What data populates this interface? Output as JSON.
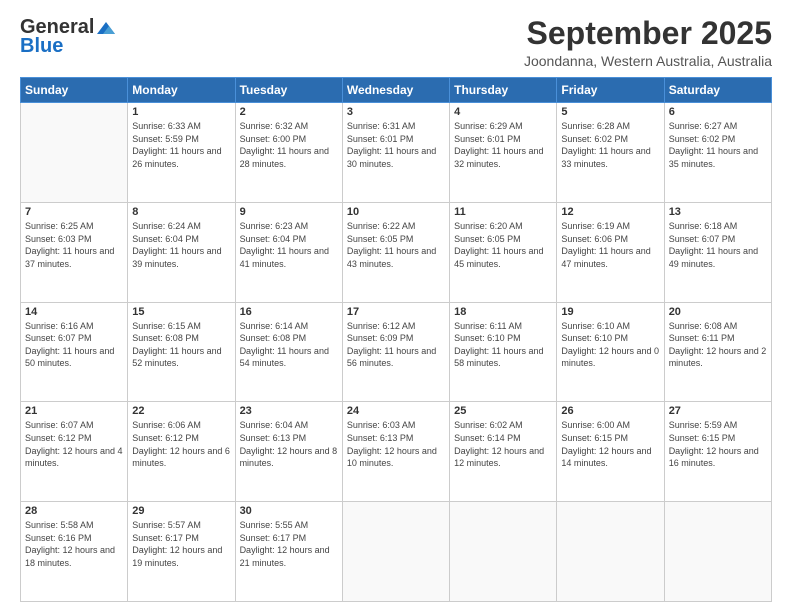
{
  "logo": {
    "general": "General",
    "blue": "Blue"
  },
  "header": {
    "month": "September 2025",
    "location": "Joondanna, Western Australia, Australia"
  },
  "weekdays": [
    "Sunday",
    "Monday",
    "Tuesday",
    "Wednesday",
    "Thursday",
    "Friday",
    "Saturday"
  ],
  "weeks": [
    [
      {
        "day": "",
        "empty": true
      },
      {
        "day": "1",
        "sunrise": "6:33 AM",
        "sunset": "5:59 PM",
        "daylight": "11 hours and 26 minutes."
      },
      {
        "day": "2",
        "sunrise": "6:32 AM",
        "sunset": "6:00 PM",
        "daylight": "11 hours and 28 minutes."
      },
      {
        "day": "3",
        "sunrise": "6:31 AM",
        "sunset": "6:01 PM",
        "daylight": "11 hours and 30 minutes."
      },
      {
        "day": "4",
        "sunrise": "6:29 AM",
        "sunset": "6:01 PM",
        "daylight": "11 hours and 32 minutes."
      },
      {
        "day": "5",
        "sunrise": "6:28 AM",
        "sunset": "6:02 PM",
        "daylight": "11 hours and 33 minutes."
      },
      {
        "day": "6",
        "sunrise": "6:27 AM",
        "sunset": "6:02 PM",
        "daylight": "11 hours and 35 minutes."
      }
    ],
    [
      {
        "day": "7",
        "sunrise": "6:25 AM",
        "sunset": "6:03 PM",
        "daylight": "11 hours and 37 minutes."
      },
      {
        "day": "8",
        "sunrise": "6:24 AM",
        "sunset": "6:04 PM",
        "daylight": "11 hours and 39 minutes."
      },
      {
        "day": "9",
        "sunrise": "6:23 AM",
        "sunset": "6:04 PM",
        "daylight": "11 hours and 41 minutes."
      },
      {
        "day": "10",
        "sunrise": "6:22 AM",
        "sunset": "6:05 PM",
        "daylight": "11 hours and 43 minutes."
      },
      {
        "day": "11",
        "sunrise": "6:20 AM",
        "sunset": "6:05 PM",
        "daylight": "11 hours and 45 minutes."
      },
      {
        "day": "12",
        "sunrise": "6:19 AM",
        "sunset": "6:06 PM",
        "daylight": "11 hours and 47 minutes."
      },
      {
        "day": "13",
        "sunrise": "6:18 AM",
        "sunset": "6:07 PM",
        "daylight": "11 hours and 49 minutes."
      }
    ],
    [
      {
        "day": "14",
        "sunrise": "6:16 AM",
        "sunset": "6:07 PM",
        "daylight": "11 hours and 50 minutes."
      },
      {
        "day": "15",
        "sunrise": "6:15 AM",
        "sunset": "6:08 PM",
        "daylight": "11 hours and 52 minutes."
      },
      {
        "day": "16",
        "sunrise": "6:14 AM",
        "sunset": "6:08 PM",
        "daylight": "11 hours and 54 minutes."
      },
      {
        "day": "17",
        "sunrise": "6:12 AM",
        "sunset": "6:09 PM",
        "daylight": "11 hours and 56 minutes."
      },
      {
        "day": "18",
        "sunrise": "6:11 AM",
        "sunset": "6:10 PM",
        "daylight": "11 hours and 58 minutes."
      },
      {
        "day": "19",
        "sunrise": "6:10 AM",
        "sunset": "6:10 PM",
        "daylight": "12 hours and 0 minutes."
      },
      {
        "day": "20",
        "sunrise": "6:08 AM",
        "sunset": "6:11 PM",
        "daylight": "12 hours and 2 minutes."
      }
    ],
    [
      {
        "day": "21",
        "sunrise": "6:07 AM",
        "sunset": "6:12 PM",
        "daylight": "12 hours and 4 minutes."
      },
      {
        "day": "22",
        "sunrise": "6:06 AM",
        "sunset": "6:12 PM",
        "daylight": "12 hours and 6 minutes."
      },
      {
        "day": "23",
        "sunrise": "6:04 AM",
        "sunset": "6:13 PM",
        "daylight": "12 hours and 8 minutes."
      },
      {
        "day": "24",
        "sunrise": "6:03 AM",
        "sunset": "6:13 PM",
        "daylight": "12 hours and 10 minutes."
      },
      {
        "day": "25",
        "sunrise": "6:02 AM",
        "sunset": "6:14 PM",
        "daylight": "12 hours and 12 minutes."
      },
      {
        "day": "26",
        "sunrise": "6:00 AM",
        "sunset": "6:15 PM",
        "daylight": "12 hours and 14 minutes."
      },
      {
        "day": "27",
        "sunrise": "5:59 AM",
        "sunset": "6:15 PM",
        "daylight": "12 hours and 16 minutes."
      }
    ],
    [
      {
        "day": "28",
        "sunrise": "5:58 AM",
        "sunset": "6:16 PM",
        "daylight": "12 hours and 18 minutes."
      },
      {
        "day": "29",
        "sunrise": "5:57 AM",
        "sunset": "6:17 PM",
        "daylight": "12 hours and 19 minutes."
      },
      {
        "day": "30",
        "sunrise": "5:55 AM",
        "sunset": "6:17 PM",
        "daylight": "12 hours and 21 minutes."
      },
      {
        "day": "",
        "empty": true
      },
      {
        "day": "",
        "empty": true
      },
      {
        "day": "",
        "empty": true
      },
      {
        "day": "",
        "empty": true
      }
    ]
  ]
}
